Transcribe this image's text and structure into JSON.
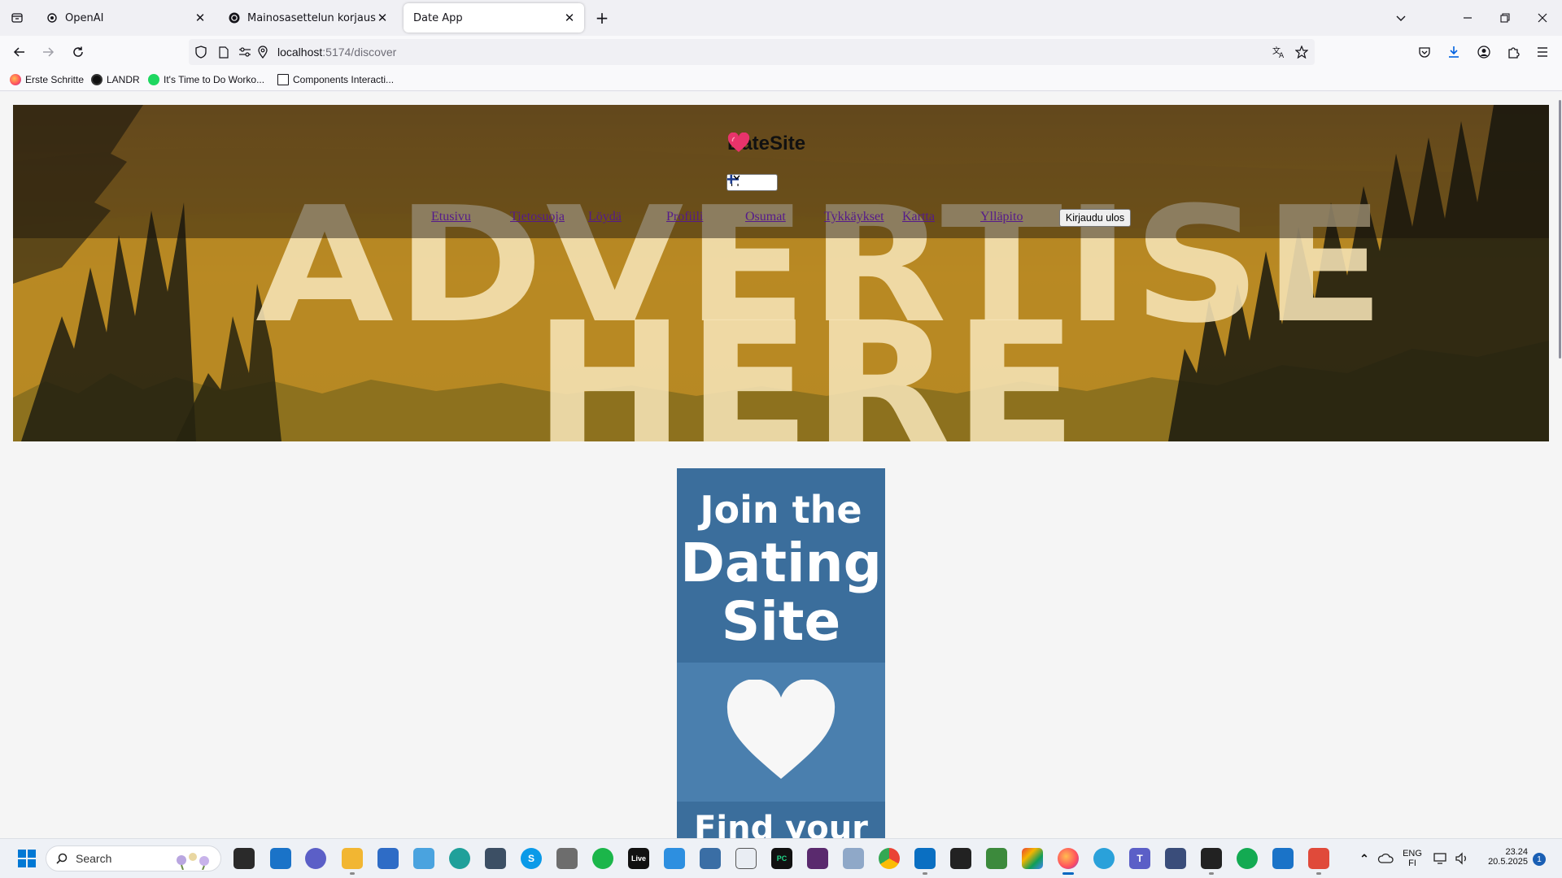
{
  "browser": {
    "tabs": [
      {
        "title": "OpenAI",
        "icon": "openai-icon",
        "active": false
      },
      {
        "title": "Mainosasettelun korjaus",
        "icon": "chatgpt-icon",
        "active": false
      },
      {
        "title": "Date App",
        "icon": "none",
        "active": true
      }
    ],
    "url_host": "localhost",
    "url_path": ":5174/discover",
    "bookmarks": [
      {
        "label": "Erste Schritte",
        "icon": "firefox-icon"
      },
      {
        "label": "LANDR",
        "icon": "landr-icon"
      },
      {
        "label": "It's Time to Do Worko...",
        "icon": "spotify-icon"
      },
      {
        "label": "Components Interacti...",
        "icon": "page-icon"
      }
    ]
  },
  "site": {
    "brand": "DateSite",
    "language": "FI",
    "nav": [
      "Etusivu",
      "Tietosuoja",
      "Löydä",
      "Profiili",
      "Osumat",
      "Tykkäykset",
      "Kartta",
      "Ylläpito"
    ],
    "logout": "Kirjaudu ulos",
    "hero_ad_line1": "ADVERTISE",
    "hero_ad_line2": "HERE",
    "banner": {
      "line1": "Join the",
      "line2": "Dating",
      "line3": "Site",
      "line4": "Find your"
    }
  },
  "taskbar": {
    "search_placeholder": "Search",
    "lang_top": "ENG",
    "lang_bottom": "FI",
    "time": "23.24",
    "date": "20.5.2025",
    "notifications": "1"
  },
  "colors": {
    "hero_gold": "#c6921e",
    "banner_blue": "#3b6e9c",
    "banner_blue_light": "#4a7fae",
    "nav_link": "#551a8b",
    "heart_pink": "#e8336b"
  }
}
